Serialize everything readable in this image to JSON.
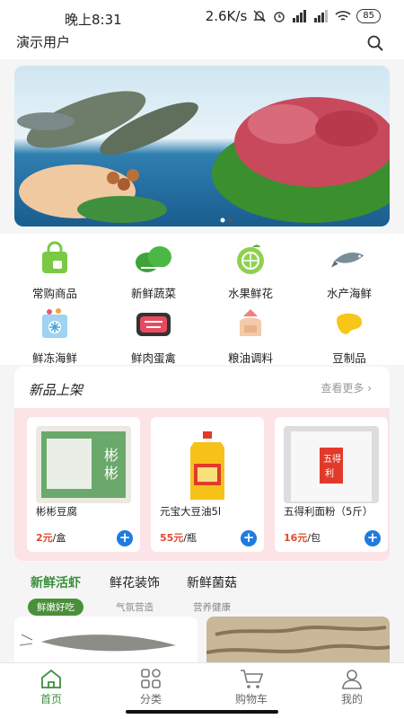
{
  "status": {
    "time": "晚上8:31",
    "speed": "2.6K/s",
    "battery": "85"
  },
  "header": {
    "title": "演示用户"
  },
  "categories": [
    {
      "label": "常购商品",
      "icon": "shopping-bag-icon"
    },
    {
      "label": "新鲜蔬菜",
      "icon": "vegetable-icon"
    },
    {
      "label": "水果鲜花",
      "icon": "fruit-icon"
    },
    {
      "label": "水产海鲜",
      "icon": "fish-icon"
    },
    {
      "label": "鲜冻海鲜",
      "icon": "frozen-icon"
    },
    {
      "label": "鲜肉蛋禽",
      "icon": "meat-icon"
    },
    {
      "label": "粮油调料",
      "icon": "grain-sack-icon"
    },
    {
      "label": "豆制品",
      "icon": "bean-icon"
    }
  ],
  "new_products": {
    "title": "新品上架",
    "more": "查看更多",
    "items": [
      {
        "name": "彬彬豆腐",
        "price": "2元",
        "unit": "/盒"
      },
      {
        "name": "元宝大豆油5l",
        "price": "55元",
        "unit": "/瓶"
      },
      {
        "name": "五得利面粉（5斤）",
        "price": "16元",
        "unit": "/包"
      }
    ]
  },
  "tabs": [
    {
      "title": "新鲜活虾",
      "subtitle": "鲜嫩好吃"
    },
    {
      "title": "鲜花装饰",
      "subtitle": "气氛营造"
    },
    {
      "title": "新鲜菌菇",
      "subtitle": "营养健康"
    }
  ],
  "navbar": [
    {
      "label": "首页",
      "icon": "home-icon"
    },
    {
      "label": "分类",
      "icon": "category-icon"
    },
    {
      "label": "购物车",
      "icon": "cart-icon"
    },
    {
      "label": "我的",
      "icon": "user-icon"
    }
  ],
  "colors": {
    "accent": "#3c8f3c",
    "price": "#e04a2f",
    "add": "#1f7be0",
    "pink": "#fbe3e6"
  }
}
